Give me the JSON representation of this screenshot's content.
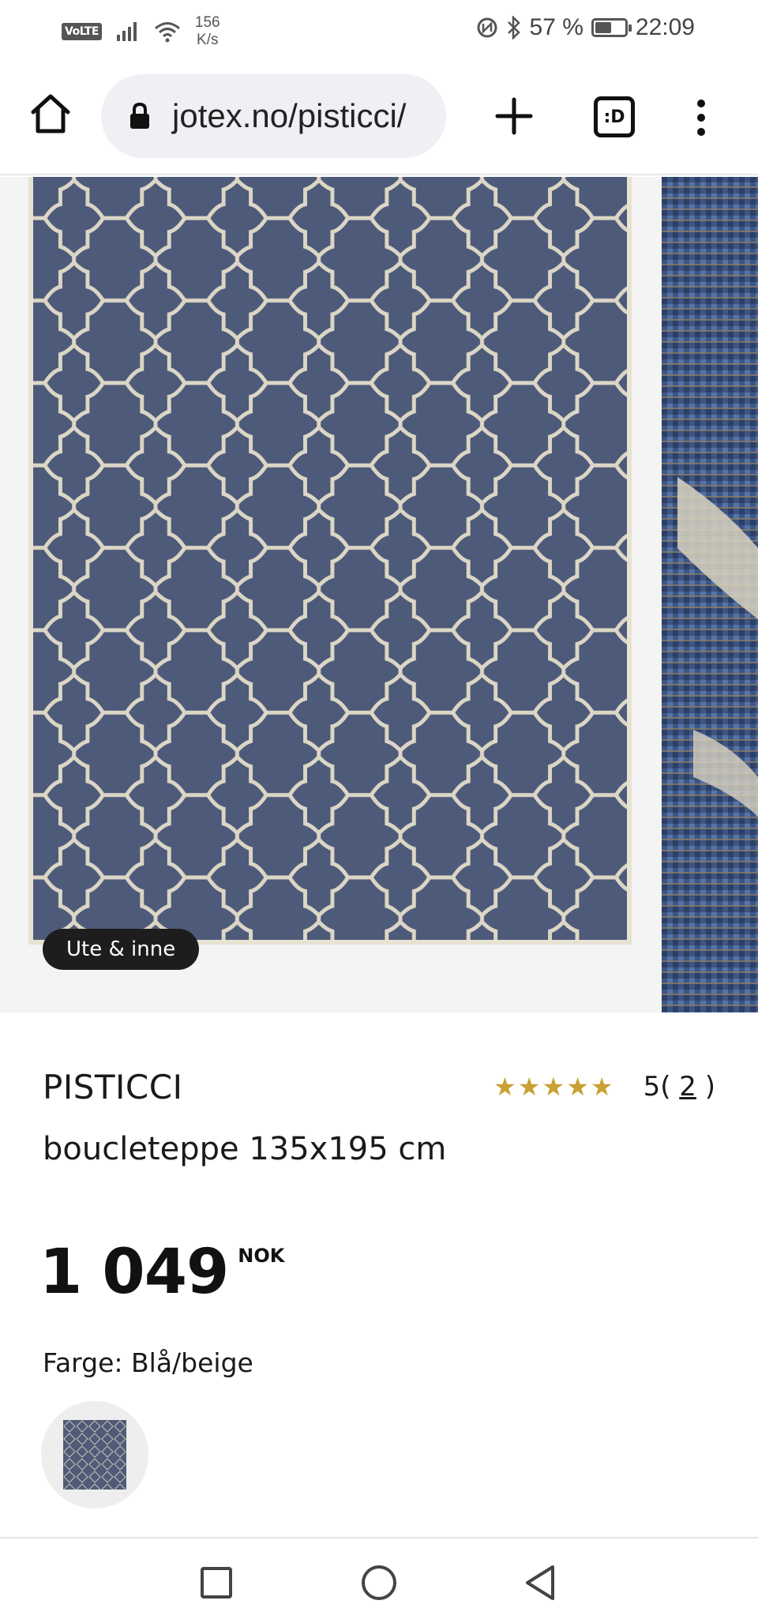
{
  "status_bar": {
    "network_badge": "VoLTE",
    "speed_value": "156",
    "speed_unit": "K/s",
    "battery_percent": "57 %",
    "battery_level": 0.57,
    "time": "22:09",
    "icons": [
      "signal-icon",
      "wifi-icon",
      "nfc-icon",
      "bluetooth-icon",
      "battery-icon"
    ]
  },
  "browser": {
    "url": "jotex.no/pisticci/",
    "tabs_label": ":D",
    "icons": [
      "home-icon",
      "lock-icon",
      "plus-icon",
      "more-vertical-icon"
    ]
  },
  "gallery": {
    "badge": "Ute & inne",
    "rug_color": "#4d5a79",
    "pattern_color": "#dcd6c6"
  },
  "product": {
    "name": "PISTICCI",
    "description": "boucleteppe 135x195 cm",
    "rating": {
      "stars": "★★★★★",
      "score": "5",
      "open_paren": "(",
      "count": "2",
      "close_paren": ")",
      "star_color": "#c9a033"
    },
    "price": {
      "value": "1 049",
      "currency": "NOK"
    },
    "color_label": "Farge: Blå/beige"
  },
  "nav_bar": {
    "icons": [
      "recent-apps-icon",
      "home-circle-icon",
      "back-icon"
    ]
  }
}
